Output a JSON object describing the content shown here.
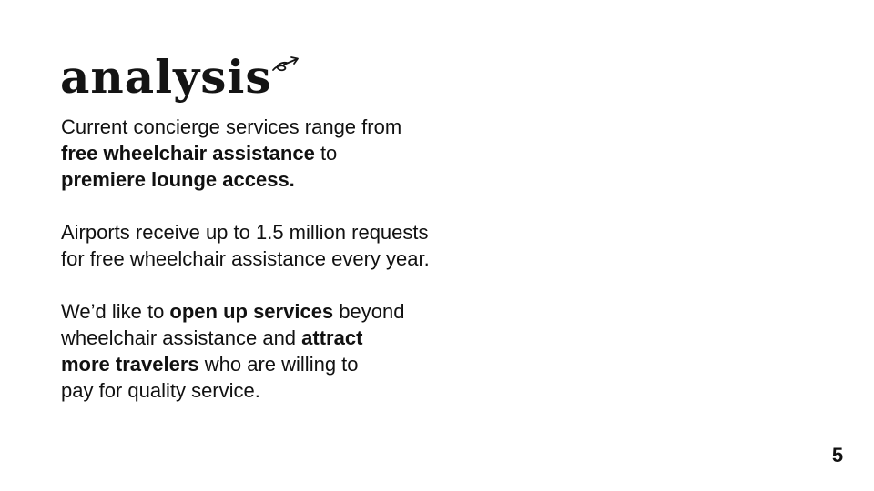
{
  "slide": {
    "title": "analysis",
    "title_icon": "flourish-arrow-icon",
    "paragraph_1": {
      "part_1": "Current concierge services range from",
      "bold_1": "free wheelchair assistance",
      "part_2": " to",
      "bold_2": "premiere lounge access."
    },
    "paragraph_2": {
      "line_1": "Airports receive up to 1.5 million requests",
      "line_2": "for free wheelchair assistance every year."
    },
    "paragraph_3": {
      "part_1": "We’d like to ",
      "bold_1": "open up services",
      "part_2": " beyond",
      "part_3": "wheelchair assistance and ",
      "bold_2": "attract",
      "bold_3": "more travelers",
      "part_4": " who are willing to",
      "part_5": "pay for quality service."
    },
    "page_number": "5",
    "colors": {
      "background": "#ffffff",
      "text": "#111111"
    }
  }
}
